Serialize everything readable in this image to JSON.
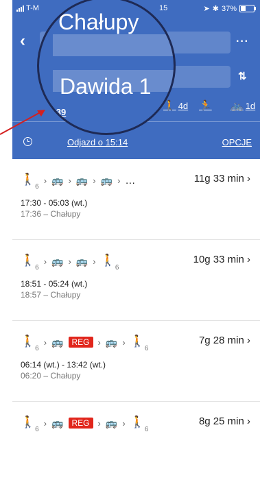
{
  "status": {
    "carrier": "T-M",
    "time": "15",
    "battery": "37%"
  },
  "header": {
    "from": "Chałupy",
    "to": "Dawida 1",
    "modes": [
      {
        "icon": "car-icon",
        "label": "5g 39"
      },
      {
        "icon": "walk-icon",
        "label": "4d"
      },
      {
        "icon": "run-icon",
        "label": ""
      },
      {
        "icon": "bike-icon",
        "label": "1d"
      }
    ],
    "departure": "Odjazd o 15:14",
    "options": "OPCJE"
  },
  "routes": [
    {
      "walk_minutes": "6",
      "extra": "…",
      "reg": "",
      "duration": "11g 33 min",
      "times": "17:30 - 05:03 (wt.)",
      "first_stop": "17:36 – Chałupy"
    },
    {
      "walk_minutes": "6",
      "end_walk": "6",
      "reg": "",
      "duration": "10g 33 min",
      "times": "18:51 - 05:24 (wt.)",
      "first_stop": "18:57 – Chałupy"
    },
    {
      "walk_minutes": "6",
      "end_walk": "6",
      "reg": "REG",
      "duration": "7g 28 min",
      "times": "06:14 (wt.) - 13:42 (wt.)",
      "first_stop": "06:20 – Chałupy"
    },
    {
      "walk_minutes": "6",
      "end_walk": "6",
      "reg": "REG",
      "duration": "8g 25 min",
      "times": "",
      "first_stop": ""
    }
  ],
  "colors": {
    "header": "#3f6cc0",
    "reg_badge": "#e1261c"
  }
}
